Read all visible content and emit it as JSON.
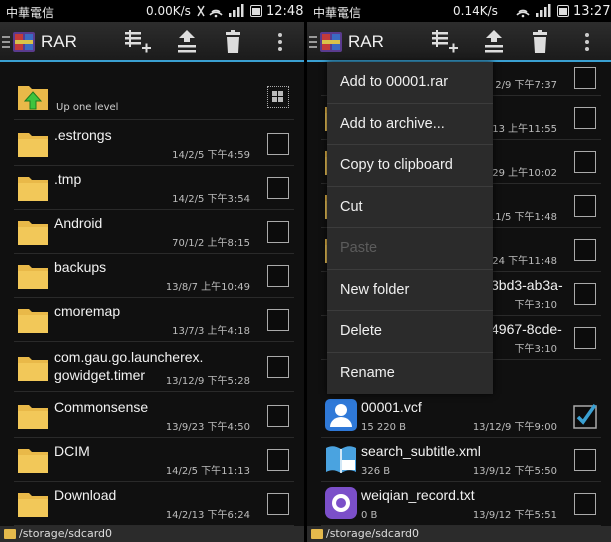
{
  "status_left": {
    "carrier": "中華電信",
    "speed": "0.00K/s",
    "time": "12:48"
  },
  "status_right": {
    "carrier": "中華電信",
    "speed": "0.14K/s",
    "time": "13:27"
  },
  "app": {
    "title": "RAR"
  },
  "left_list": {
    "up_label": "Up one level",
    "rows": [
      {
        "name": ".estrongs",
        "meta": "14/2/5 下午4:59"
      },
      {
        "name": ".tmp",
        "meta": "14/2/5 下午3:54"
      },
      {
        "name": "Android",
        "meta": "70/1/2 上午8:15"
      },
      {
        "name": "backups",
        "meta": "13/8/7 上午10:49"
      },
      {
        "name": "cmoremap",
        "meta": "13/7/3 上午4:18"
      },
      {
        "name": "com.gau.go.launcherex.",
        "name2": "gowidget.timer",
        "meta": "13/12/9 下午5:28"
      },
      {
        "name": "Commonsense",
        "meta": "13/9/23 下午4:50"
      },
      {
        "name": "DCIM",
        "meta": "14/2/5 下午11:13"
      },
      {
        "name": "Download",
        "meta": "14/2/13 下午6:24"
      }
    ]
  },
  "right_list": {
    "rows": [
      {
        "name": "",
        "meta": "2/9 下午7:37"
      },
      {
        "name": "",
        "meta": "/13 上午11:55"
      },
      {
        "name": "",
        "meta": "29 上午10:02"
      },
      {
        "name": "",
        "meta": "11/5 下午1:48"
      },
      {
        "name": "",
        "meta": "24 下午11:48"
      },
      {
        "name": "3bd3-ab3a-",
        "meta": "下午3:10"
      },
      {
        "name": "4967-8cde-",
        "meta": "下午3:10"
      },
      {
        "name": "00001.vcf",
        "size": "15 220 B",
        "meta": "13/12/9 下午9:00"
      },
      {
        "name": "search_subtitle.xml",
        "size": "326 B",
        "meta": "13/9/12 下午5:50"
      },
      {
        "name": "weiqian_record.txt",
        "size": "0 B",
        "meta": "13/9/12 下午5:51"
      }
    ]
  },
  "context_menu": {
    "items": [
      {
        "label": "Add to 00001.rar",
        "enabled": true
      },
      {
        "label": "Add to archive...",
        "enabled": true
      },
      {
        "label": "Copy to clipboard",
        "enabled": true
      },
      {
        "label": "Cut",
        "enabled": true
      },
      {
        "label": "Paste",
        "enabled": false
      },
      {
        "label": "New folder",
        "enabled": true
      },
      {
        "label": "Delete",
        "enabled": true
      },
      {
        "label": "Rename",
        "enabled": true
      }
    ]
  },
  "path": {
    "left": "/storage/sdcard0",
    "right": "/storage/sdcard0"
  },
  "colors": {
    "accent": "#3aa0d2",
    "folder": "#e9b949",
    "check": "#3aa0d2",
    "up_arrow": "#3ec43e"
  },
  "icons": {
    "up": "up-level-icon",
    "folder": "folder-icon",
    "vcf": "contact-icon",
    "xml": "xml-file-icon",
    "txt": "audio-record-icon",
    "add": "add-to-archive-icon",
    "extract": "extract-icon",
    "delete": "trash-icon",
    "overflow": "overflow-menu-icon"
  }
}
